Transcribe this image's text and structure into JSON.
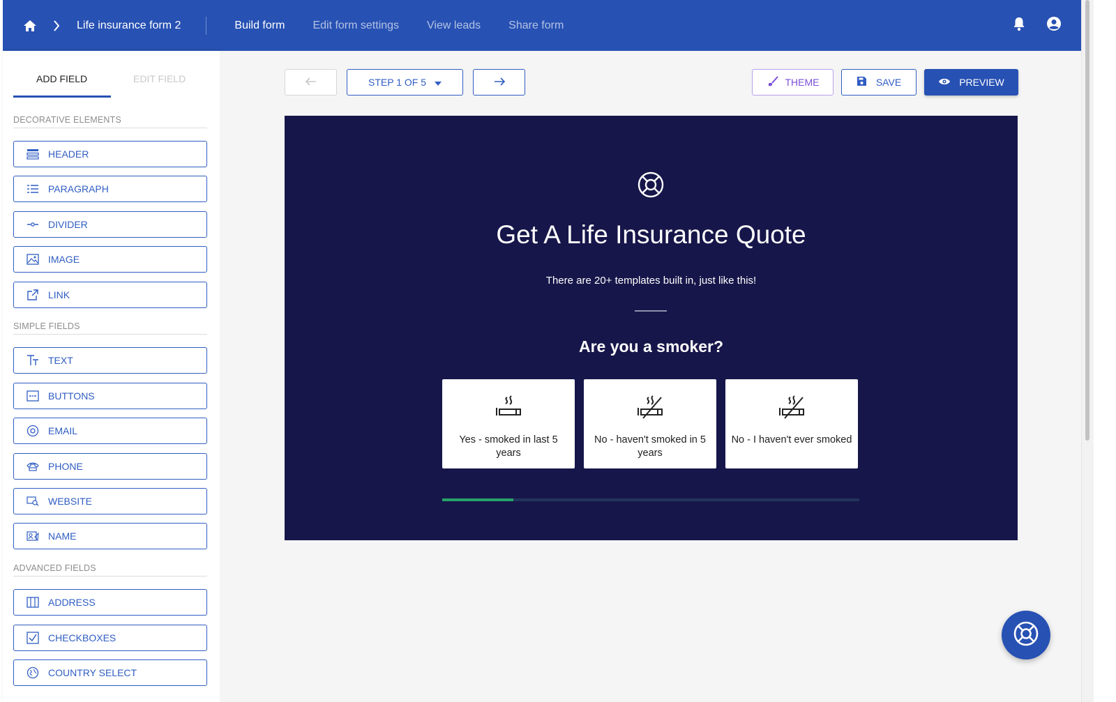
{
  "topbar": {
    "breadcrumb": "Life insurance form 2",
    "nav": [
      "Build form",
      "Edit form settings",
      "View leads",
      "Share form"
    ],
    "active_nav": "Build form"
  },
  "sidebar": {
    "tabs": [
      "ADD FIELD",
      "EDIT FIELD"
    ],
    "sections": [
      {
        "label": "DECORATIVE ELEMENTS",
        "items": [
          {
            "label": "HEADER",
            "icon": "header-icon"
          },
          {
            "label": "PARAGRAPH",
            "icon": "paragraph-icon"
          },
          {
            "label": "DIVIDER",
            "icon": "divider-icon"
          },
          {
            "label": "IMAGE",
            "icon": "image-icon"
          },
          {
            "label": "LINK",
            "icon": "link-icon"
          }
        ]
      },
      {
        "label": "SIMPLE FIELDS",
        "items": [
          {
            "label": "TEXT",
            "icon": "text-icon"
          },
          {
            "label": "BUTTONS",
            "icon": "buttons-icon"
          },
          {
            "label": "EMAIL",
            "icon": "email-icon"
          },
          {
            "label": "PHONE",
            "icon": "phone-icon"
          },
          {
            "label": "WEBSITE",
            "icon": "website-icon"
          },
          {
            "label": "NAME",
            "icon": "name-icon"
          }
        ]
      },
      {
        "label": "ADVANCED FIELDS",
        "items": [
          {
            "label": "ADDRESS",
            "icon": "address-icon"
          },
          {
            "label": "CHECKBOXES",
            "icon": "checkbox-icon"
          },
          {
            "label": "COUNTRY SELECT",
            "icon": "globe-icon"
          }
        ]
      }
    ]
  },
  "toolbar": {
    "step_label": "STEP 1 OF 5",
    "theme_label": "THEME",
    "save_label": "SAVE",
    "preview_label": "PREVIEW"
  },
  "form": {
    "title": "Get A Life Insurance Quote",
    "subtitle": "There are 20+ templates built in, just like this!",
    "question": "Are you a smoker?",
    "options": [
      "Yes - smoked in last 5 years",
      "No - haven't smoked in 5 years",
      "No - I haven't ever smoked"
    ],
    "progress": 0.17
  },
  "colors": {
    "brand": "#2751b3",
    "form_background": "#17164a",
    "progress": "#27a36a"
  }
}
